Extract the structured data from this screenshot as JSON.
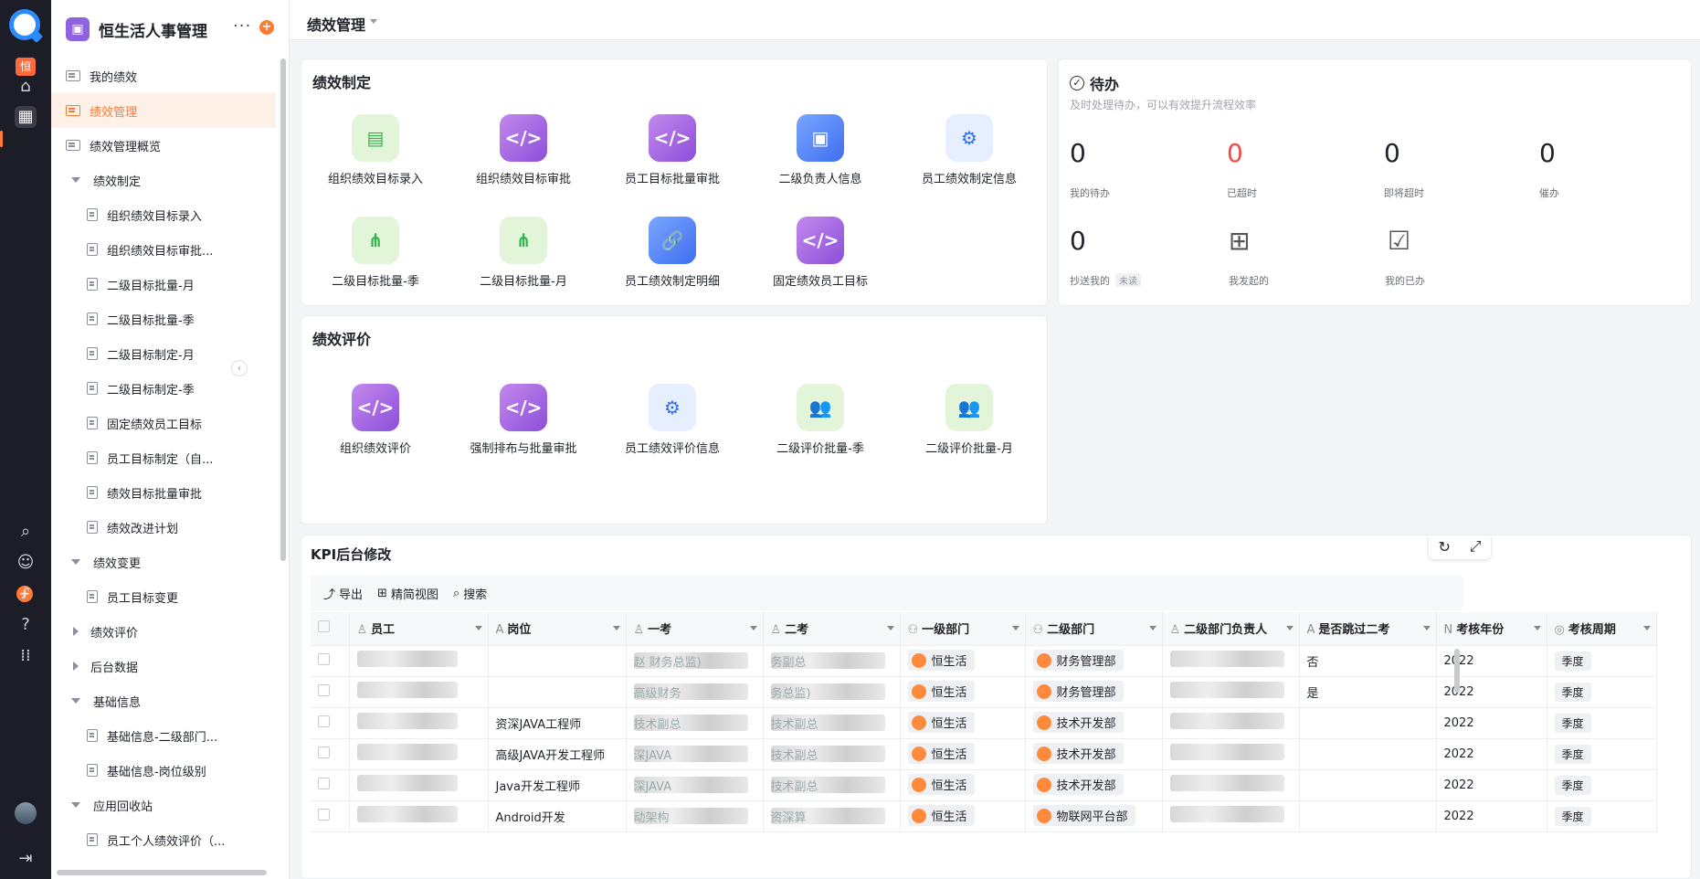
{
  "rail": {
    "brand_badge": "恒",
    "icons": [
      "home-icon",
      "apps-icon",
      "plus-icon",
      "search-icon",
      "contacts-icon",
      "bell-icon",
      "help-icon",
      "grid-icon",
      "collapse-icon"
    ]
  },
  "sidebar": {
    "app_title": "恒生活人事管理",
    "more": "···",
    "add": "+",
    "items": [
      {
        "label": "我的绩效",
        "level": 0,
        "type": "page"
      },
      {
        "label": "绩效管理",
        "level": 0,
        "type": "page",
        "active": true
      },
      {
        "label": "绩效管理概览",
        "level": 0,
        "type": "page"
      },
      {
        "label": "绩效制定",
        "level": 0,
        "type": "group",
        "open": true
      },
      {
        "label": "组织绩效目标录入",
        "level": 1,
        "type": "doc"
      },
      {
        "label": "组织绩效目标审批...",
        "level": 1,
        "type": "doc"
      },
      {
        "label": "二级目标批量-月",
        "level": 1,
        "type": "doc"
      },
      {
        "label": "二级目标批量-季",
        "level": 1,
        "type": "doc"
      },
      {
        "label": "二级目标制定-月",
        "level": 1,
        "type": "doc"
      },
      {
        "label": "二级目标制定-季",
        "level": 1,
        "type": "doc"
      },
      {
        "label": "固定绩效员工目标",
        "level": 1,
        "type": "doc"
      },
      {
        "label": "员工目标制定（自...",
        "level": 1,
        "type": "doc"
      },
      {
        "label": "绩效目标批量审批",
        "level": 1,
        "type": "doc"
      },
      {
        "label": "绩效改进计划",
        "level": 1,
        "type": "doc"
      },
      {
        "label": "绩效变更",
        "level": 0,
        "type": "group",
        "open": true
      },
      {
        "label": "员工目标变更",
        "level": 1,
        "type": "doc"
      },
      {
        "label": "绩效评价",
        "level": 0,
        "type": "group",
        "open": false
      },
      {
        "label": "后台数据",
        "level": 0,
        "type": "group",
        "open": false
      },
      {
        "label": "基础信息",
        "level": 0,
        "type": "group",
        "open": true
      },
      {
        "label": "基础信息-二级部门...",
        "level": 1,
        "type": "doc"
      },
      {
        "label": "基础信息-岗位级别",
        "level": 1,
        "type": "doc"
      },
      {
        "label": "应用回收站",
        "level": 0,
        "type": "group",
        "open": true
      },
      {
        "label": "员工个人绩效评价（...",
        "level": 1,
        "type": "doc"
      }
    ]
  },
  "header": {
    "page_title": "绩效管理"
  },
  "formulation": {
    "title": "绩效制定",
    "tiles": [
      {
        "label": "组织绩效目标录入",
        "style": "g-green",
        "glyph": "▤"
      },
      {
        "label": "组织绩效目标审批",
        "style": "g-purple",
        "glyph": "</>"
      },
      {
        "label": "员工目标批量审批",
        "style": "g-purple",
        "glyph": "</>"
      },
      {
        "label": "二级负责人信息",
        "style": "g-blue",
        "glyph": "▣"
      },
      {
        "label": "员工绩效制定信息",
        "style": "g-lightblue",
        "glyph": "⚙"
      },
      {
        "label": "二级目标批量-季",
        "style": "g-green",
        "glyph": "⋔"
      },
      {
        "label": "二级目标批量-月",
        "style": "g-green",
        "glyph": "⋔"
      },
      {
        "label": "员工绩效制定明细",
        "style": "g-blue",
        "glyph": "🔗"
      },
      {
        "label": "固定绩效员工目标",
        "style": "g-purple",
        "glyph": "</>"
      }
    ]
  },
  "evaluation": {
    "title": "绩效评价",
    "tiles": [
      {
        "label": "组织绩效评价",
        "style": "g-purple",
        "glyph": "</>"
      },
      {
        "label": "强制排布与批量审批",
        "style": "g-purple",
        "glyph": "</>"
      },
      {
        "label": "员工绩效评价信息",
        "style": "g-lightblue",
        "glyph": "⚙"
      },
      {
        "label": "二级评价批量-季",
        "style": "g-green",
        "glyph": "👥"
      },
      {
        "label": "二级评价批量-月",
        "style": "g-green",
        "glyph": "👥"
      }
    ]
  },
  "todo": {
    "title": "待办",
    "subtitle": "及时处理待办，可以有效提升流程效率",
    "stats": [
      {
        "value": "0",
        "label": "我的待办",
        "color": "#1f2329"
      },
      {
        "value": "0",
        "label": "已超时",
        "color": "#f54a45"
      },
      {
        "value": "0",
        "label": "即将超时",
        "color": "#1f2329"
      },
      {
        "value": "0",
        "label": "催办",
        "color": "#1f2329"
      },
      {
        "value": "0",
        "label": "抄送我的",
        "color": "#1f2329"
      }
    ],
    "unread": "未读",
    "launched": "我发起的",
    "done": "我的已办"
  },
  "kpi": {
    "title": "KPI后台修改",
    "toolbar": {
      "export": "导出",
      "view": "精简视图",
      "search": "搜索"
    },
    "columns": [
      "员工",
      "岗位",
      "一考",
      "二考",
      "一级部门",
      "二级部门",
      "二级部门负责人",
      "是否跳过二考",
      "考核年份",
      "考核周期"
    ],
    "rows": [
      {
        "post": "",
        "l1": "赵 财务总监)",
        "l2": "务副总",
        "dept1": "恒生活",
        "dept2": "财务管理部",
        "skip": "否",
        "year": "2022",
        "period": "季度"
      },
      {
        "post": "",
        "l1": "高级财务",
        "l2": "务总监)",
        "dept1": "恒生活",
        "dept2": "财务管理部",
        "skip": "是",
        "year": "2022",
        "period": "季度"
      },
      {
        "post": "资深JAVA工程师",
        "l1": "技术副总",
        "l2": "技术副总",
        "dept1": "恒生活",
        "dept2": "技术开发部",
        "skip": "",
        "year": "2022",
        "period": "季度"
      },
      {
        "post": "高级JAVA开发工程师",
        "l1": "深JAVA",
        "l2": "技术副总",
        "dept1": "恒生活",
        "dept2": "技术开发部",
        "skip": "",
        "year": "2022",
        "period": "季度"
      },
      {
        "post": "Java开发工程师",
        "l1": "深JAVA",
        "l2": "技术副总",
        "dept1": "恒生活",
        "dept2": "技术开发部",
        "skip": "",
        "year": "2022",
        "period": "季度"
      },
      {
        "post": "Android开发",
        "l1": "动架构",
        "l2": "资深算",
        "dept1": "恒生活",
        "dept2": "物联网平台部",
        "skip": "",
        "year": "2022",
        "period": "季度"
      }
    ]
  }
}
